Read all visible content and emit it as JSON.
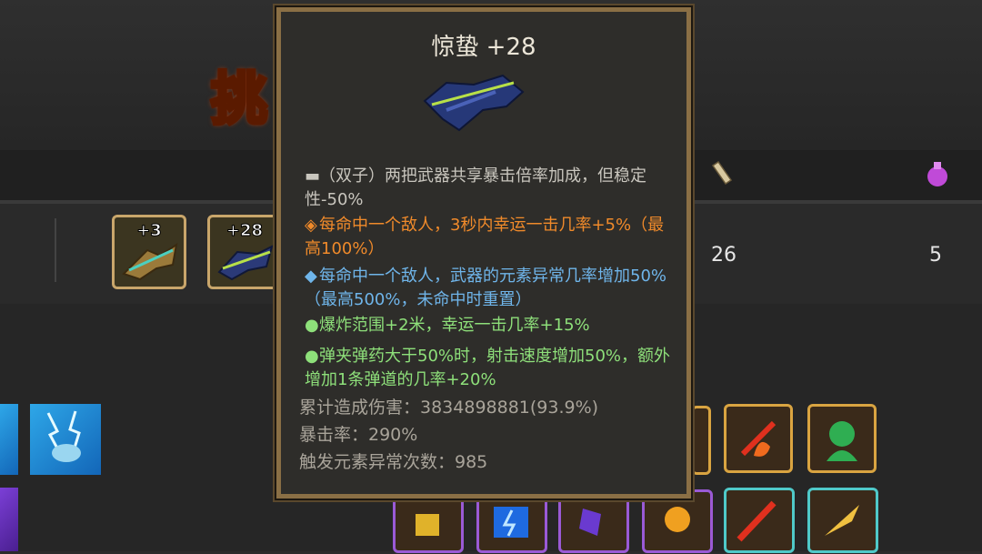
{
  "title_glyph": "挑",
  "weapons": [
    {
      "level": "+3"
    },
    {
      "level": "+28"
    }
  ],
  "stats_row": {
    "value_a": "26",
    "value_b": "5"
  },
  "tooltip": {
    "title": "惊蛰 +28",
    "lines": [
      {
        "color": "grey",
        "bullet": "▬",
        "text": "（双子）两把武器共享暴击倍率加成，但稳定性-50%"
      },
      {
        "color": "orange",
        "bullet": "◈",
        "text": "每命中一个敌人，3秒内幸运一击几率+5%（最高100%）"
      },
      {
        "color": "blue",
        "bullet": "◆",
        "text": "每命中一个敌人，武器的元素异常几率增加50%（最高500%，未命中时重置）"
      },
      {
        "color": "green",
        "bullet": "●",
        "text": "爆炸范围+2米，幸运一击几率+15%"
      },
      {
        "color": "green",
        "bullet": "●",
        "text": "弹夹弹药大于50%时，射击速度增加50%，额外增加1条弹道的几率+20%"
      }
    ],
    "summary": [
      "累计造成伤害：3834898881(93.9%)",
      "暴击率：290%",
      "触发元素异常次数：985"
    ]
  },
  "colors": {
    "border": "#8a6f45",
    "orange": "#f08a2a",
    "blue": "#6fb5ea",
    "green": "#8ee07a"
  }
}
